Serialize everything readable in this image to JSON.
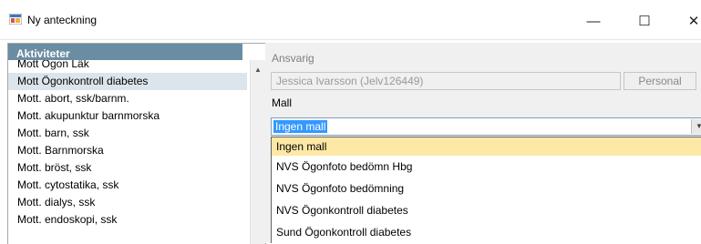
{
  "window": {
    "title": "Ny anteckning",
    "minimize": "—",
    "maximize": "☐",
    "close": "✕"
  },
  "left_panel": {
    "header": "Aktiviteter",
    "items": [
      "Mott Ögon Läk",
      "Mott Ögonkontroll diabetes",
      "Mott. abort, ssk/barnm.",
      "Mott. akupunktur barnmorska",
      "Mott. barn, ssk",
      "Mott. Barnmorska",
      "Mott. bröst, ssk",
      "Mott. cytostatika, ssk",
      "Mott. dialys, ssk",
      "Mott. endoskopi, ssk"
    ],
    "selected_index": 1,
    "scroll_up_icon": "▲"
  },
  "right_panel": {
    "ansvarig_label": "Ansvarig",
    "ansvarig_value": "Jessica Ivarsson (Jelv126449)",
    "personal_button": "Personal",
    "mall_label": "Mall",
    "mall_value": "Ingen mall",
    "mall_arrow": "▼",
    "dropdown_options": [
      "Ingen mall",
      "NVS Ögonfoto bedömn Hbg",
      "NVS Ögonfoto bedömning",
      "NVS Ögonkontroll diabetes",
      "Sund Ögonkontroll diabetes"
    ],
    "highlighted_index": 0
  },
  "colors": {
    "header_bg": "#6a8da3",
    "selected_row": "#dde5ec",
    "highlight": "#fde8a5",
    "selection_blue": "#3399ff"
  }
}
